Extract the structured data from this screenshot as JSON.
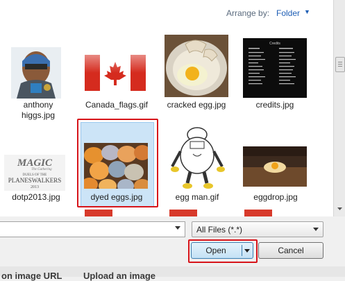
{
  "toolbar": {
    "arrange_label": "Arrange by:",
    "arrange_value": "Folder"
  },
  "files": [
    {
      "name": "anthony higgs.jpg",
      "line1": "anthony",
      "line2": "higgs.jpg"
    },
    {
      "name": "Canada_flags.gif"
    },
    {
      "name": "cracked egg.jpg"
    },
    {
      "name": "credits.jpg",
      "thumb_heading": "Credits"
    },
    {
      "name": "dotp2013.jpg",
      "thumb_text": {
        "brand": "MAGIC",
        "sub": "The Gathering",
        "line1": "DUELS OF THE",
        "line2": "PLANESWALKERS",
        "year": "2013"
      }
    },
    {
      "name": "dyed eggs.jpg",
      "selected": true
    },
    {
      "name": "egg man.gif"
    },
    {
      "name": "eggdrop.jpg"
    }
  ],
  "bottom_bar": {
    "filename_value": "",
    "filetype_value": "All Files (*.*)",
    "open_label": "Open",
    "cancel_label": "Cancel"
  },
  "underlying_page": {
    "left_text": "on image URL",
    "right_text": "Upload an image"
  },
  "colors": {
    "highlight": "#d7141a",
    "selection": "#cce4f7",
    "link": "#1e5eb5"
  }
}
